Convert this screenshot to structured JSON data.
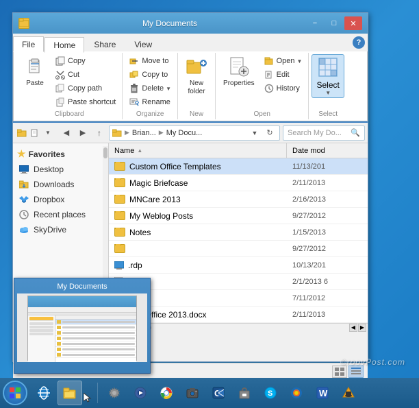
{
  "window": {
    "title": "My Documents",
    "icon": "folder"
  },
  "titlebar": {
    "minimize": "−",
    "maximize": "□",
    "close": "✕"
  },
  "menu": {
    "tabs": [
      "File",
      "Home",
      "Share",
      "View"
    ],
    "active_tab": "Home",
    "help_icon": "?"
  },
  "ribbon": {
    "groups": [
      {
        "label": "Clipboard",
        "buttons": [
          {
            "id": "paste",
            "label": "Paste",
            "type": "large"
          },
          {
            "id": "copy",
            "label": "Copy",
            "type": "small"
          },
          {
            "id": "cut",
            "label": "Cut",
            "type": "small"
          },
          {
            "id": "copy-path",
            "label": "Copy path",
            "type": "small"
          },
          {
            "id": "paste-shortcut",
            "label": "Paste shortcut",
            "type": "small"
          }
        ]
      },
      {
        "label": "Organize",
        "buttons": [
          {
            "id": "move-to",
            "label": "Move to",
            "type": "small"
          },
          {
            "id": "copy-to",
            "label": "Copy to",
            "type": "small"
          },
          {
            "id": "delete",
            "label": "Delete",
            "type": "small"
          },
          {
            "id": "rename",
            "label": "Rename",
            "type": "small"
          }
        ]
      },
      {
        "label": "New",
        "buttons": [
          {
            "id": "new-folder",
            "label": "New\nfolder",
            "type": "large"
          }
        ]
      },
      {
        "label": "Open",
        "buttons": [
          {
            "id": "properties",
            "label": "Properties",
            "type": "large-split"
          },
          {
            "id": "open",
            "label": "Open",
            "type": "small"
          },
          {
            "id": "edit",
            "label": "Edit",
            "type": "small"
          },
          {
            "id": "history",
            "label": "History",
            "type": "small"
          }
        ]
      },
      {
        "label": "Select",
        "buttons": [
          {
            "id": "select-all",
            "label": "Select",
            "type": "select-highlight"
          }
        ]
      }
    ]
  },
  "navigation": {
    "back_title": "Back",
    "forward_title": "Forward",
    "up_title": "Up",
    "crumbs": [
      "Brian...",
      "My Docu..."
    ],
    "search_placeholder": "Search My Do..."
  },
  "sidebar": {
    "sections": [
      {
        "header": "Favorites",
        "icon": "star",
        "items": [
          {
            "label": "Desktop",
            "icon": "monitor"
          },
          {
            "label": "Downloads",
            "icon": "download"
          },
          {
            "label": "Dropbox",
            "icon": "dropbox"
          },
          {
            "label": "Recent places",
            "icon": "clock"
          },
          {
            "label": "SkyDrive",
            "icon": "cloud"
          }
        ]
      }
    ]
  },
  "file_list": {
    "columns": [
      {
        "id": "name",
        "label": "Name"
      },
      {
        "id": "date_modified",
        "label": "Date mod"
      }
    ],
    "files": [
      {
        "name": "Custom Office Templates",
        "date": "11/13/201",
        "type": "folder",
        "selected": true
      },
      {
        "name": "Magic Briefcase",
        "date": "2/11/2013",
        "type": "folder"
      },
      {
        "name": "MNCare 2013",
        "date": "2/16/2013",
        "type": "folder"
      },
      {
        "name": "My Weblog Posts",
        "date": "9/27/2012",
        "type": "folder"
      },
      {
        "name": "Notes",
        "date": "1/15/2013",
        "type": "folder"
      },
      {
        "name": "",
        "date": "9/27/2012",
        "type": "folder"
      },
      {
        "name": "",
        "date": "10/13/201",
        "type": "rdp"
      },
      {
        "name": "",
        "date": "2/1/2013 6",
        "type": "txt"
      },
      {
        "name": "",
        "date": "7/11/2012",
        "type": "file-txt"
      },
      {
        "name": "s for Office 2013.docx",
        "date": "2/11/2013",
        "type": "docx"
      }
    ]
  },
  "thumbnail": {
    "title": "My Documents"
  },
  "statusbar": {
    "view_buttons": [
      "list",
      "details"
    ]
  },
  "taskbar": {
    "icons": [
      {
        "id": "ie",
        "label": "Internet Explorer",
        "char": "🌐"
      },
      {
        "id": "folder",
        "label": "File Explorer",
        "char": "📁",
        "active": true
      },
      {
        "id": "cursor",
        "label": "",
        "char": ""
      },
      {
        "id": "settings",
        "label": "Settings",
        "char": "⚙"
      },
      {
        "id": "media",
        "label": "Media Player",
        "char": "🎵"
      },
      {
        "id": "chrome",
        "label": "Chrome",
        "char": "🔵"
      },
      {
        "id": "camera",
        "label": "Camera",
        "char": "📷"
      },
      {
        "id": "outlook",
        "label": "Outlook",
        "char": "📧"
      },
      {
        "id": "store",
        "label": "Store",
        "char": "🛍"
      },
      {
        "id": "skype",
        "label": "Skype",
        "char": "💬"
      },
      {
        "id": "firefox",
        "label": "Firefox",
        "char": "🦊"
      },
      {
        "id": "word",
        "label": "Word",
        "char": "W"
      },
      {
        "id": "vlc",
        "label": "VLC",
        "char": "🔶"
      }
    ]
  },
  "watermark": {
    "text": "©roovPost.com"
  }
}
